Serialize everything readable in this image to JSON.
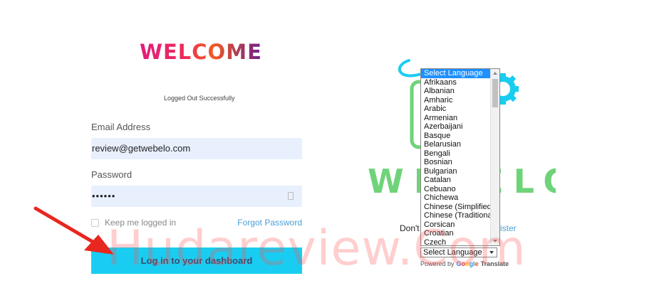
{
  "login": {
    "heading": "WELCOME",
    "status_message": "Logged Out Successfully",
    "email_label": "Email Address",
    "email_value": "review@getwebelo.com",
    "password_label": "Password",
    "password_value": "••••••",
    "keep_logged_in_label": "Keep me logged in",
    "forgot_password_label": "Forgot Password",
    "login_button_label": "Log in to your dashboard"
  },
  "brand": {
    "logo_text": "WEBELO",
    "logo_colors": {
      "primary": "#19cdf2",
      "secondary": "#6fd37a"
    }
  },
  "signup": {
    "prefix_visible": "Don't",
    "register_visible": "ister"
  },
  "language": {
    "options": [
      "Select Language",
      "Afrikaans",
      "Albanian",
      "Amharic",
      "Arabic",
      "Armenian",
      "Azerbaijani",
      "Basque",
      "Belarusian",
      "Bengali",
      "Bosnian",
      "Bulgarian",
      "Catalan",
      "Cebuano",
      "Chichewa",
      "Chinese (Simplified)",
      "Chinese (Traditional)",
      "Corsican",
      "Croatian",
      "Czech"
    ],
    "selected": "Select Language",
    "powered_by": "Powered by",
    "google_word": "Google",
    "translate_word": "Translate"
  },
  "watermark": {
    "text": "Hudareview.Com"
  },
  "colors": {
    "accent": "#19cdf2",
    "link": "#4a9fd6",
    "arrow": "#e8271f"
  }
}
